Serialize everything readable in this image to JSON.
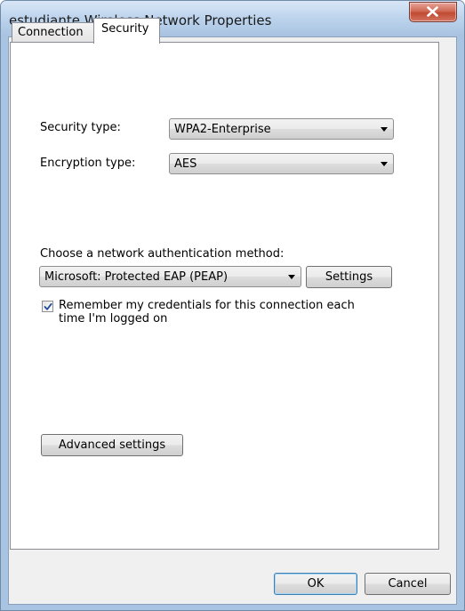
{
  "window": {
    "title": "estudiante Wireless Network Properties"
  },
  "tabs": [
    {
      "label": "Connection",
      "selected": false
    },
    {
      "label": "Security",
      "selected": true
    }
  ],
  "security": {
    "security_type_label": "Security type:",
    "security_type_value": "WPA2-Enterprise",
    "encryption_type_label": "Encryption type:",
    "encryption_type_value": "AES",
    "auth_method_label": "Choose a network authentication method:",
    "auth_method_value": "Microsoft: Protected EAP (PEAP)",
    "settings_label": "Settings",
    "remember_label": "Remember my credentials for this connection each time I'm logged on",
    "remember_checked": true,
    "advanced_label": "Advanced settings"
  },
  "footer": {
    "ok_label": "OK",
    "cancel_label": "Cancel"
  },
  "icons": {
    "close": "close-icon",
    "checkmark": "checkmark-icon",
    "dropdown": "chevron-down-icon"
  },
  "colors": {
    "close_button": "#c14a33",
    "default_button_border": "#3c7fb1",
    "checkmark": "#1f4b99"
  }
}
